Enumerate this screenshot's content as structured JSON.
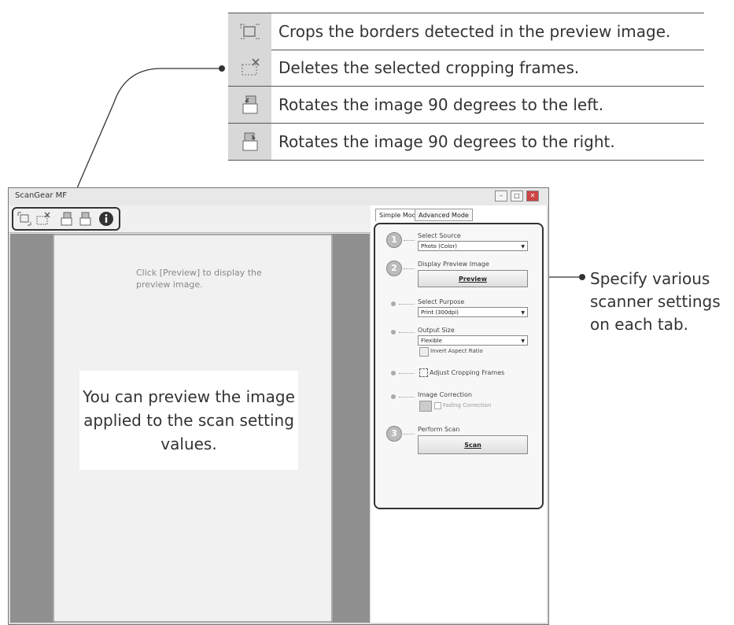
{
  "legend": [
    {
      "icon": "crop-borders-icon",
      "text": "Crops the borders detected in the preview image."
    },
    {
      "icon": "delete-frames-icon",
      "text": "Deletes the selected cropping frames."
    },
    {
      "icon": "rotate-left-icon",
      "text": "Rotates the image 90 degrees to the left."
    },
    {
      "icon": "rotate-right-icon",
      "text": "Rotates the image 90 degrees to the right."
    }
  ],
  "side_note": "Specify various scanner settings on each tab.",
  "window": {
    "title": "ScanGear MF",
    "controls": [
      "minimize",
      "maximize",
      "close"
    ]
  },
  "toolbar": {
    "icons": [
      "crop-borders-icon",
      "delete-frames-icon",
      "rotate-left-icon",
      "rotate-right-icon",
      "info-icon"
    ]
  },
  "preview": {
    "hint": "Click [Preview] to display the preview image.",
    "note": "You can preview the image applied to the scan setting values."
  },
  "tabs": [
    "Simple Mode",
    "Advanced Mode"
  ],
  "steps": {
    "select_source": {
      "label": "Select Source",
      "value": "Photo (Color)"
    },
    "display_preview": {
      "label": "Display Preview Image",
      "button": "Preview"
    },
    "select_purpose": {
      "label": "Select Purpose",
      "value": "Print (300dpi)"
    },
    "output_size": {
      "label": "Output Size",
      "value": "Flexible",
      "invert": "Invert Aspect Ratio"
    },
    "adjust_cropping": {
      "label": "Adjust Cropping Frames"
    },
    "image_correction": {
      "label": "Image Correction",
      "fading": "Fading Correction"
    },
    "perform_scan": {
      "label": "Perform Scan",
      "button": "Scan"
    }
  }
}
